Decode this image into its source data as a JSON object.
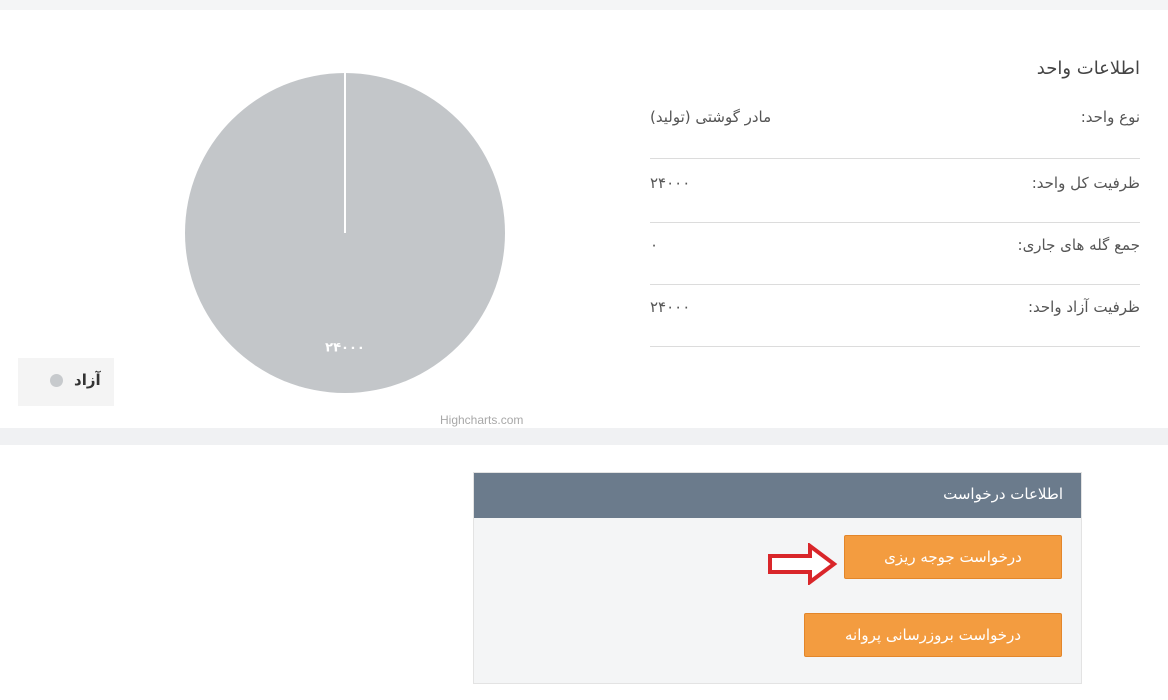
{
  "unit_info": {
    "title": "اطلاعات واحد",
    "rows": [
      {
        "label": "نوع واحد:",
        "value": "مادر گوشتی (تولید)"
      },
      {
        "label": "ظرفیت کل واحد:",
        "value": "۲۴۰۰۰"
      },
      {
        "label": "جمع گله های جاری:",
        "value": "۰"
      },
      {
        "label": "ظرفیت آزاد واحد:",
        "value": "۲۴۰۰۰"
      }
    ]
  },
  "chart_data": {
    "type": "pie",
    "slices": [
      {
        "name": "آزاد",
        "value": 24000,
        "label": "۲۴۰۰۰",
        "color": "#c3c6c9"
      }
    ],
    "legend_position": "bottom-left",
    "credits": "Highcharts.com"
  },
  "request_panel": {
    "title": "اطلاعات درخواست",
    "buttons": {
      "hatch_request": "درخواست جوجه ریزی",
      "license_update_request": "درخواست بروزرسانی پروانه"
    }
  },
  "colors": {
    "accent_orange": "#f39c40",
    "panel_header": "#6b7b8c",
    "arrow_red": "#d9262a"
  }
}
